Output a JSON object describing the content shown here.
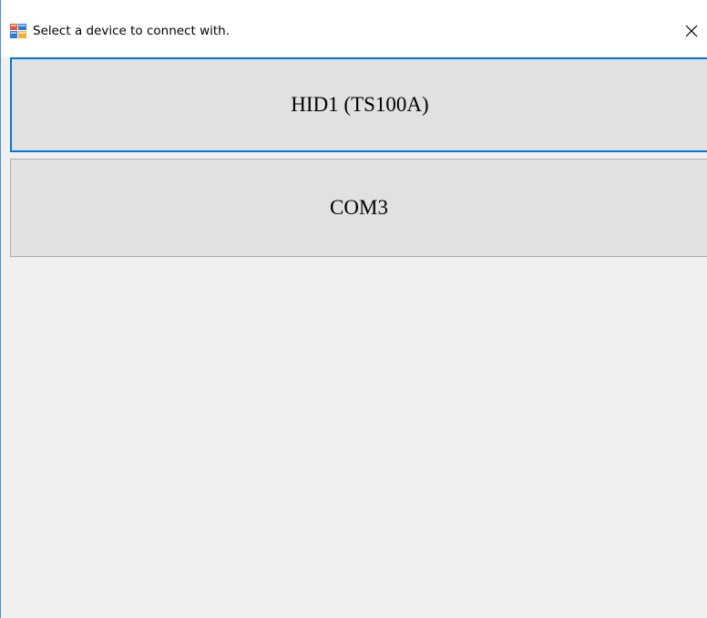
{
  "window": {
    "title": "Select a device to connect with.",
    "icon": "app-window-icon",
    "close_icon": "close-icon"
  },
  "devices": [
    {
      "label": "HID1 (TS100A)",
      "focused": true
    },
    {
      "label": "COM3",
      "focused": false
    }
  ],
  "colors": {
    "focus_border": "#0078d7",
    "button_face": "#e1e1e1",
    "client_background": "#f0f0f0"
  }
}
